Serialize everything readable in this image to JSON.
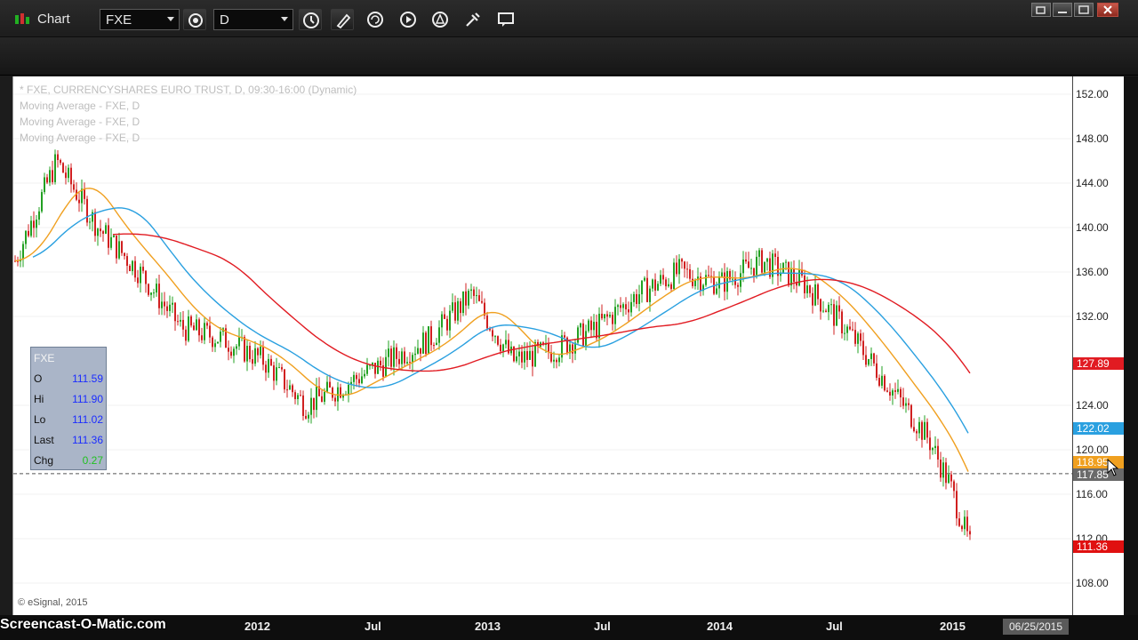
{
  "window": {
    "title": "Chart",
    "symbol": "FXE",
    "interval": "D"
  },
  "legend": {
    "main": "* FXE, CURRENCYSHARES EURO TRUST, D, 09:30-16:00 (Dynamic)",
    "ma1": "Moving Average - FXE, D",
    "ma2": "Moving Average - FXE, D",
    "ma3": "Moving Average - FXE, D"
  },
  "info_panel": {
    "symbol": "FXE",
    "rows": [
      {
        "label": "O",
        "value": "111.59"
      },
      {
        "label": "Hi",
        "value": "111.90"
      },
      {
        "label": "Lo",
        "value": "111.02"
      },
      {
        "label": "Last",
        "value": "111.36"
      },
      {
        "label": "Chg",
        "value": "0.27"
      }
    ]
  },
  "y_axis": {
    "ticks": [
      "152.00",
      "148.00",
      "144.00",
      "140.00",
      "136.00",
      "132.00",
      "124.00",
      "120.00",
      "116.00",
      "112.00",
      "108.00"
    ],
    "tags": {
      "ma_red": "127.89",
      "ma_blue": "122.02",
      "ma_orange": "118.95",
      "crosshair": "117.85",
      "last": "111.36"
    }
  },
  "x_axis": {
    "ticks": [
      "2012",
      "Jul",
      "2013",
      "Jul",
      "2014",
      "Jul",
      "2015"
    ],
    "cursor_date": "06/25/2015"
  },
  "copyright": "© eSignal, 2015",
  "watermark": "Screencast-O-Matic.com",
  "colors": {
    "ma_red": "#e11b22",
    "ma_blue": "#2aa0e0",
    "ma_orange": "#f0a020",
    "candle_up": "#22a022",
    "candle_down": "#d02020",
    "last_tag": "#e01010"
  },
  "chart_data": {
    "type": "candlestick",
    "symbol": "FXE",
    "close_approx": {
      "x": [
        "2011-04",
        "2011-06",
        "2011-08",
        "2011-10",
        "2011-12",
        "2012-02",
        "2012-04",
        "2012-06",
        "2012-08",
        "2012-10",
        "2012-12",
        "2013-02",
        "2013-04",
        "2013-06",
        "2013-08",
        "2013-10",
        "2013-12",
        "2014-02",
        "2014-04",
        "2014-06",
        "2014-08",
        "2014-10",
        "2014-12",
        "2015-01",
        "2015-02"
      ],
      "y": [
        137.0,
        146.0,
        140.0,
        136.0,
        131.0,
        130.0,
        128.0,
        124.0,
        126.0,
        128.0,
        130.0,
        134.0,
        128.0,
        129.0,
        131.0,
        134.0,
        136.0,
        135.0,
        137.0,
        135.0,
        131.0,
        126.0,
        121.0,
        117.0,
        111.36
      ]
    },
    "series": [
      {
        "name": "Moving Average - FXE, D",
        "last": 127.89
      },
      {
        "name": "Moving Average - FXE, D",
        "last": 122.02
      },
      {
        "name": "Moving Average - FXE, D",
        "last": 118.95
      }
    ],
    "ylim": [
      106,
      154
    ],
    "y_ticks": [
      152,
      148,
      144,
      140,
      136,
      132,
      124,
      120,
      116,
      112,
      108
    ],
    "x_ticks": [
      "2012",
      "Jul",
      "2013",
      "Jul",
      "2014",
      "Jul",
      "2015"
    ],
    "title": "* FXE, CURRENCYSHARES EURO TRUST, D, 09:30-16:00 (Dynamic)"
  }
}
